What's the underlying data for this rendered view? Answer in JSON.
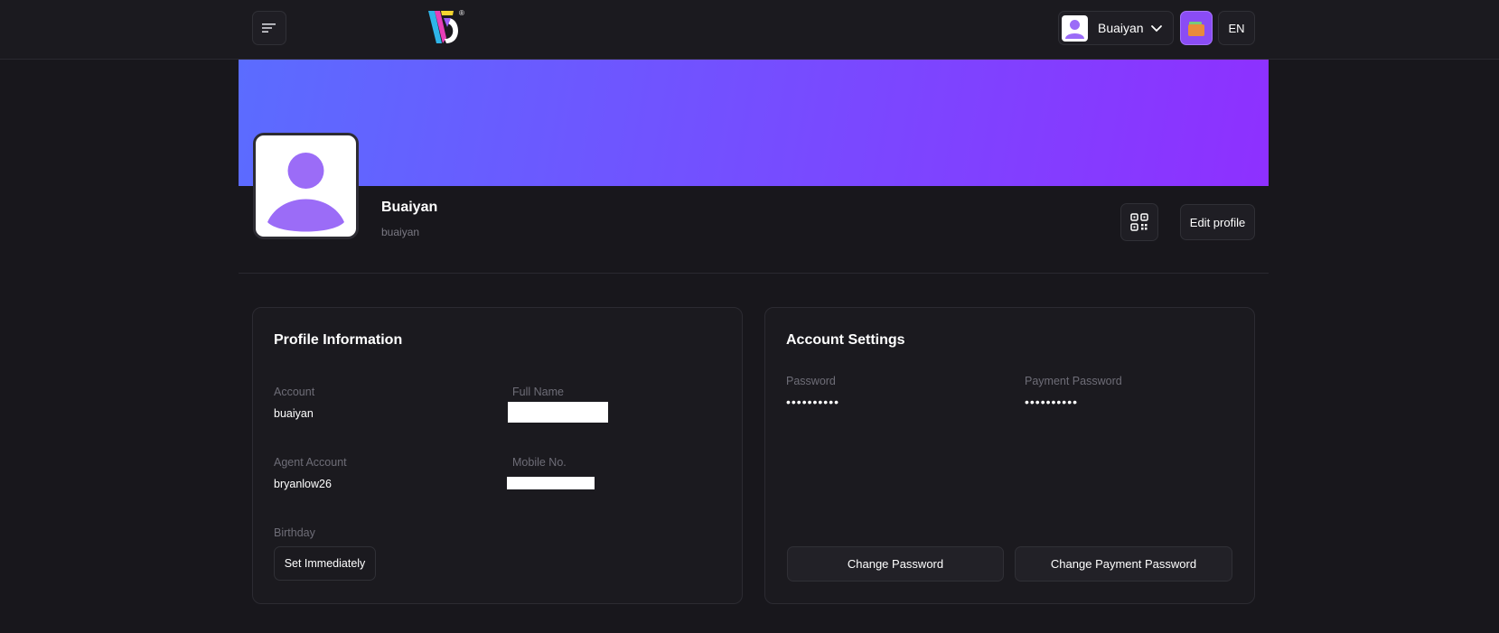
{
  "header": {
    "user_name": "Buaiyan",
    "language": "EN",
    "logo_mark": "®"
  },
  "profile": {
    "display_name": "Buaiyan",
    "username": "buaiyan",
    "edit_label": "Edit profile"
  },
  "profile_info": {
    "title": "Profile Information",
    "account_label": "Account",
    "account_value": "buaiyan",
    "full_name_label": "Full Name",
    "agent_label": "Agent Account",
    "agent_value": "bryanlow26",
    "mobile_label": "Mobile No.",
    "birthday_label": "Birthday",
    "birthday_button": "Set Immediately"
  },
  "account_settings": {
    "title": "Account Settings",
    "password_label": "Password",
    "password_value": "••••••••••",
    "payment_password_label": "Payment Password",
    "payment_password_value": "••••••••••",
    "change_password_label": "Change Password",
    "change_payment_password_label": "Change Payment Password"
  },
  "colors": {
    "background": "#18171c",
    "banner_start": "#5b6cff",
    "banner_end": "#8e30ff",
    "accent": "#8a4cf5",
    "avatar_purple": "#9b6cf7"
  }
}
